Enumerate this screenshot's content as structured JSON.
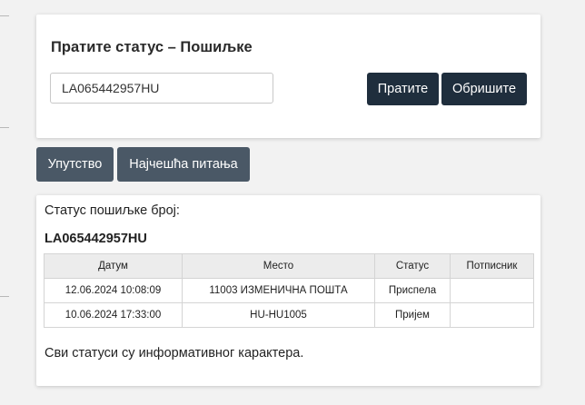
{
  "search": {
    "title": "Пратите статус – Пошиљке",
    "input_value": "LA065442957HU",
    "track_label": "Пратите",
    "clear_label": "Обришите"
  },
  "nav": {
    "instructions_label": "Упутство",
    "faq_label": "Најчешћа питања"
  },
  "result": {
    "heading": "Статус пошиљке број:",
    "number": "LA065442957HU",
    "columns": [
      "Датум",
      "Место",
      "Статус",
      "Потписник"
    ],
    "rows": [
      {
        "date": "12.06.2024 10:08:09",
        "place": "11003 ИЗМЕНИЧНА ПОШТА",
        "status": "Приспела",
        "signer": ""
      },
      {
        "date": "10.06.2024 17:33:00",
        "place": "HU-HU1005",
        "status": "Пријем",
        "signer": ""
      }
    ],
    "footnote": "Сви статуси су информативног карактера."
  },
  "colors": {
    "primary_button": "#1f2e3d",
    "secondary_button": "#4a5866"
  }
}
